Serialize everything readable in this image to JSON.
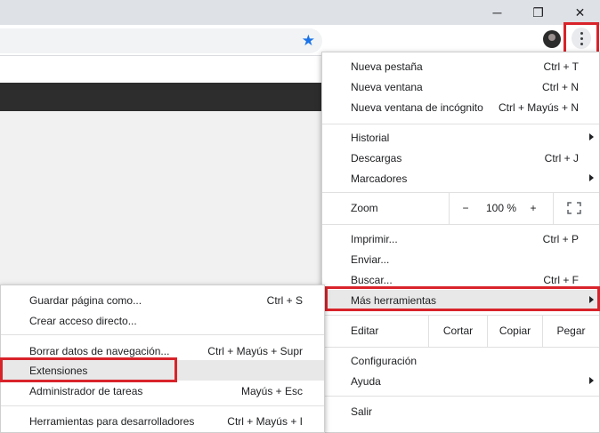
{
  "window": {
    "minimize_glyph": "─",
    "restore_glyph": "❐",
    "close_glyph": "✕"
  },
  "toolbar": {
    "star_icon": "star-icon",
    "star_color": "#1a73e8",
    "highlight_color": "#d8232a"
  },
  "chrome_menu": {
    "new_tab": {
      "label": "Nueva pestaña",
      "shortcut": "Ctrl + T"
    },
    "new_window": {
      "label": "Nueva ventana",
      "shortcut": "Ctrl + N"
    },
    "incognito": {
      "label": "Nueva ventana de incógnito",
      "shortcut": "Ctrl + Mayús + N"
    },
    "history": {
      "label": "Historial"
    },
    "downloads": {
      "label": "Descargas",
      "shortcut": "Ctrl + J"
    },
    "bookmarks": {
      "label": "Marcadores"
    },
    "zoom": {
      "label": "Zoom",
      "minus": "−",
      "value": "100 %",
      "plus": "+"
    },
    "print": {
      "label": "Imprimir...",
      "shortcut": "Ctrl + P"
    },
    "cast": {
      "label": "Enviar..."
    },
    "find": {
      "label": "Buscar...",
      "shortcut": "Ctrl + F"
    },
    "more_tools": {
      "label": "Más herramientas"
    },
    "edit": {
      "label": "Editar",
      "cut": "Cortar",
      "copy": "Copiar",
      "paste": "Pegar"
    },
    "settings": {
      "label": "Configuración"
    },
    "help": {
      "label": "Ayuda"
    },
    "exit": {
      "label": "Salir"
    }
  },
  "submenu": {
    "save_page": {
      "label": "Guardar página como...",
      "shortcut": "Ctrl + S"
    },
    "create_shortcut": {
      "label": "Crear acceso directo..."
    },
    "clear_data": {
      "label": "Borrar datos de navegación...",
      "shortcut": "Ctrl + Mayús + Supr"
    },
    "extensions": {
      "label": "Extensiones"
    },
    "task_manager": {
      "label": "Administrador de tareas",
      "shortcut": "Mayús + Esc"
    },
    "dev_tools": {
      "label": "Herramientas para desarrolladores",
      "shortcut": "Ctrl + Mayús + I"
    }
  }
}
